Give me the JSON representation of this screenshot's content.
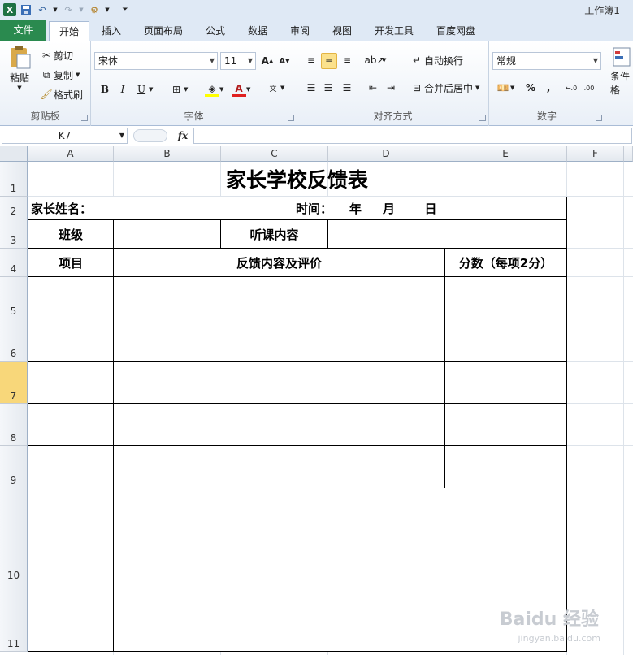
{
  "window": {
    "title": "工作簿1 -"
  },
  "tabs": [
    {
      "label": "文件"
    },
    {
      "label": "开始"
    },
    {
      "label": "插入"
    },
    {
      "label": "页面布局"
    },
    {
      "label": "公式"
    },
    {
      "label": "数据"
    },
    {
      "label": "审阅"
    },
    {
      "label": "视图"
    },
    {
      "label": "开发工具"
    },
    {
      "label": "百度网盘"
    }
  ],
  "ribbon": {
    "clipboard": {
      "paste": "粘贴",
      "cut": "剪切",
      "copy": "复制",
      "format_painter": "格式刷",
      "label": "剪贴板"
    },
    "font": {
      "name": "宋体",
      "size": "11",
      "bold": "B",
      "italic": "I",
      "underline": "U",
      "label": "字体"
    },
    "alignment": {
      "wrap": "自动换行",
      "merge": "合并后居中",
      "label": "对齐方式"
    },
    "number": {
      "format": "常规",
      "percent": "%",
      "comma": ",",
      "label": "数字"
    },
    "styles": {
      "conditional": "条件格"
    }
  },
  "formula_bar": {
    "name_box": "K7",
    "fx": "fx",
    "value": ""
  },
  "columns": [
    "A",
    "B",
    "C",
    "D",
    "E",
    "F"
  ],
  "rows": [
    "1",
    "2",
    "3",
    "4",
    "5",
    "6",
    "7",
    "8",
    "9",
    "10",
    "11"
  ],
  "active_row": "7",
  "sheet": {
    "title": "家长学校反馈表",
    "row2_left": "家长姓名：",
    "row2_right": "时间：    年     月       日",
    "class_label": "班级",
    "topic_label": "听课内容",
    "item_header": "项目",
    "feedback_header": "反馈内容及评价",
    "score_header": "分数（每项2分）"
  },
  "watermark": {
    "main": "Baidu 经验",
    "sub": "jingyan.baidu.com"
  }
}
